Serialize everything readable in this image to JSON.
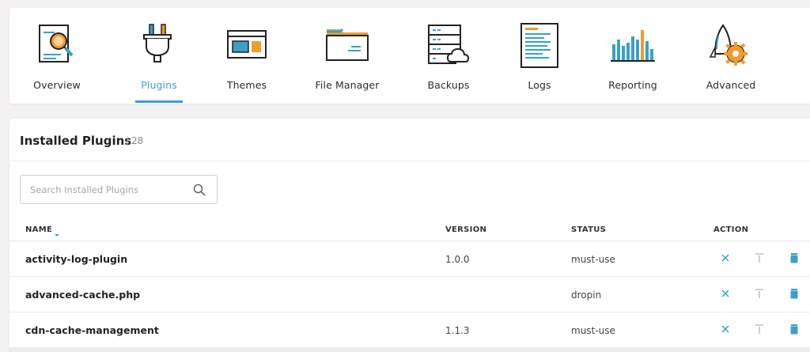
{
  "nav": {
    "items": [
      {
        "label": "Overview",
        "icon": "report-search-icon"
      },
      {
        "label": "Plugins",
        "icon": "plug-icon",
        "active": true
      },
      {
        "label": "Themes",
        "icon": "themes-window-icon"
      },
      {
        "label": "File Manager",
        "icon": "folder-icon"
      },
      {
        "label": "Backups",
        "icon": "server-cloud-icon"
      },
      {
        "label": "Logs",
        "icon": "log-document-icon"
      },
      {
        "label": "Reporting",
        "icon": "bar-chart-icon"
      },
      {
        "label": "Advanced",
        "icon": "rocket-gear-icon"
      }
    ],
    "accent_color": "#3aa0c9"
  },
  "plugins": {
    "title": "Installed Plugins",
    "count": "28",
    "search_placeholder": "Search Installed Plugins",
    "columns": {
      "name": "NAME",
      "version": "VERSION",
      "status": "STATUS",
      "action": "ACTION"
    },
    "rows": [
      {
        "name": "activity-log-plugin",
        "version": "1.0.0",
        "status": "must-use"
      },
      {
        "name": "advanced-cache.php",
        "version": "",
        "status": "dropin"
      },
      {
        "name": "cdn-cache-management",
        "version": "1.1.3",
        "status": "must-use"
      }
    ]
  },
  "colors": {
    "accent": "#3aa0c9",
    "orange": "#f39a2c",
    "dark": "#222222"
  }
}
